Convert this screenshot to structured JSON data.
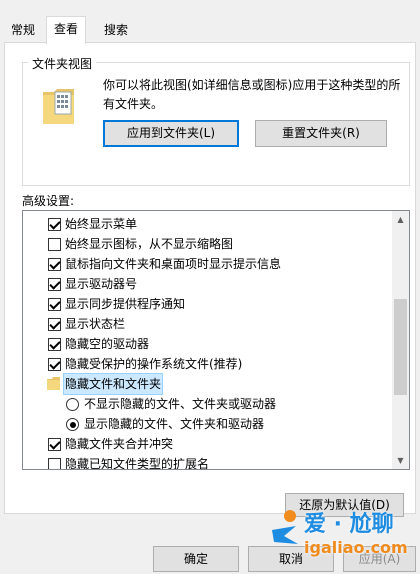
{
  "tabs": [
    {
      "label": "常规"
    },
    {
      "label": "查看"
    },
    {
      "label": "搜索"
    }
  ],
  "folder_views": {
    "title": "文件夹视图",
    "description": "你可以将此视图(如详细信息或图标)应用于这种类型的所有文件夹。",
    "apply_button": "应用到文件夹(L)",
    "reset_button": "重置文件夹(R)"
  },
  "advanced": {
    "label": "高级设置:",
    "items": [
      {
        "type": "checkbox",
        "checked": true,
        "label": "始终显示菜单"
      },
      {
        "type": "checkbox",
        "checked": false,
        "label": "始终显示图标，从不显示缩略图"
      },
      {
        "type": "checkbox",
        "checked": true,
        "label": "鼠标指向文件夹和桌面项时显示提示信息"
      },
      {
        "type": "checkbox",
        "checked": true,
        "label": "显示驱动器号"
      },
      {
        "type": "checkbox",
        "checked": true,
        "label": "显示同步提供程序通知"
      },
      {
        "type": "checkbox",
        "checked": true,
        "label": "显示状态栏"
      },
      {
        "type": "checkbox",
        "checked": true,
        "label": "隐藏空的驱动器"
      },
      {
        "type": "checkbox",
        "checked": true,
        "label": "隐藏受保护的操作系统文件(推荐)"
      },
      {
        "type": "folder",
        "label": "隐藏文件和文件夹"
      },
      {
        "type": "radio",
        "checked": false,
        "label": "不显示隐藏的文件、文件夹或驱动器"
      },
      {
        "type": "radio",
        "checked": true,
        "label": "显示隐藏的文件、文件夹和驱动器"
      },
      {
        "type": "checkbox",
        "checked": true,
        "label": "隐藏文件夹合并冲突"
      },
      {
        "type": "checkbox",
        "checked": false,
        "label": "隐藏已知文件类型的扩展名"
      }
    ]
  },
  "restore_defaults": "还原为默认值(D)",
  "footer": {
    "ok": "确定",
    "cancel": "取消",
    "apply": "应用(A)"
  },
  "watermark": {
    "brand": "爱 · 尬聊",
    "url": "igaliao.com"
  },
  "colors": {
    "accent": "#0078d7",
    "selection": "#cce8ff",
    "watermark_blue": "#1e8ce0",
    "watermark_orange": "#f08c1e"
  }
}
